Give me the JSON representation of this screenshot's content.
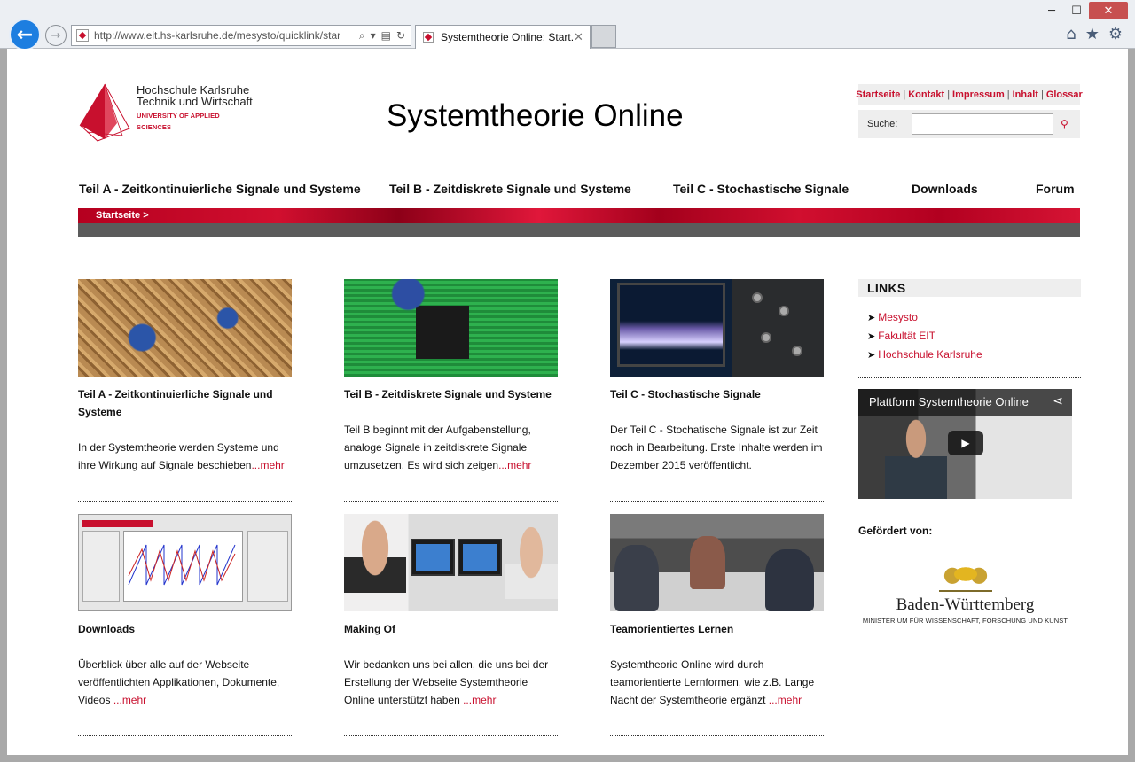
{
  "browser": {
    "url_host": "http://www.eit.hs-karlsruhe.de",
    "url_path": "/mesysto/quicklink/star",
    "tab_title": "Systemtheorie Online: Start...",
    "icons": [
      "back-icon",
      "forward-icon",
      "search-icon",
      "refresh-icon",
      "home-icon",
      "star-icon",
      "gear-icon"
    ]
  },
  "header": {
    "logo_line1": "Hochschule Karlsruhe",
    "logo_line2": "Technik und Wirtschaft",
    "logo_line3": "UNIVERSITY OF APPLIED SCIENCES",
    "site_title": "Systemtheorie Online",
    "toplinks": [
      "Startseite",
      "Kontakt",
      "Impressum",
      "Inhalt",
      "Glossar"
    ],
    "search_label": "Suche:"
  },
  "nav": {
    "items": [
      "Teil A - Zeitkontinuierliche Signale und Systeme",
      "Teil B - Zeitdiskrete Signale und Systeme",
      "Teil C - Stochastische Signale",
      "Downloads",
      "Forum"
    ],
    "breadcrumb": "Startseite >"
  },
  "cards": [
    {
      "title": "Teil A - Zeitkontinuierliche Signale und Systeme",
      "text": "In der Systemtheorie werden Systeme und ihre Wirkung auf Signale beschieben",
      "more": "...mehr"
    },
    {
      "title": "Teil B - Zeitdiskrete Signale und Systeme",
      "text": "Teil B beginnt mit der Aufgabenstellung, analoge Signale in zeitdiskrete Signale umzusetzen. Es wird sich zeigen",
      "more": "...mehr"
    },
    {
      "title": "Teil C - Stochastische Signale",
      "text": "Der Teil C - Stochatische Signale ist zur Zeit noch in Bearbeitung. Erste Inhalte werden im Dezember 2015 veröffentlicht.",
      "more": ""
    },
    {
      "title": "Downloads",
      "text": "Überblick über alle auf der Webseite veröffentlichten Applikationen, Dokumente, Videos ",
      "more": "...mehr"
    },
    {
      "title": "Making Of",
      "text": "Wir bedanken uns bei allen, die uns bei der Erstellung der Webseite Systemtheorie Online unterstützt haben ",
      "more": "...mehr"
    },
    {
      "title": "Teamorientiertes Lernen",
      "text": "Systemtheorie Online wird durch teamorientierte Lernformen, wie z.B. Lange Nacht der Systemtheorie ergänzt ",
      "more": "...mehr"
    }
  ],
  "sidebar": {
    "links_heading": "LINKS",
    "links": [
      "Mesysto",
      "Fakultät EIT",
      "Hochschule Karlsruhe"
    ],
    "video_title": "Plattform Systemtheorie Online",
    "funded_label": "Gefördert von:",
    "funder_name": "Baden-Württemberg",
    "funder_sub": "MINISTERIUM FÜR WISSENSCHAFT, FORSCHUNG UND KUNST"
  },
  "colors": {
    "accent": "#c8102e",
    "nav_bar_grey": "#5b5b5b",
    "panel_grey": "#eeeeee"
  }
}
